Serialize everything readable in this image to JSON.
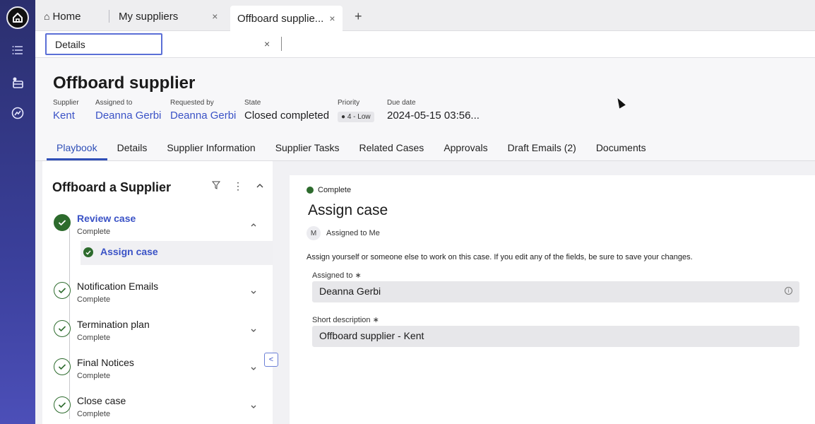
{
  "rail": {
    "icons": [
      "home-icon",
      "list-icon",
      "workspace-icon",
      "analytics-icon"
    ]
  },
  "tabs": {
    "home": "Home",
    "my_suppliers": "My suppliers",
    "offboard": "Offboard supplie...",
    "close_glyph": "×",
    "add_glyph": "+"
  },
  "subtab": {
    "label": "Details",
    "close_glyph": "×"
  },
  "record": {
    "title": "Offboard supplier",
    "fields": {
      "supplier": {
        "label": "Supplier",
        "value": "Kent"
      },
      "assigned_to": {
        "label": "Assigned to",
        "value": "Deanna Gerbi"
      },
      "requested_by": {
        "label": "Requested by",
        "value": "Deanna Gerbi"
      },
      "state": {
        "label": "State",
        "value": "Closed completed"
      },
      "priority": {
        "label": "Priority",
        "value": "4 - Low"
      },
      "due_date": {
        "label": "Due date",
        "value": "2024-05-15 03:56..."
      }
    },
    "tabs": [
      "Playbook",
      "Details",
      "Supplier Information",
      "Supplier Tasks",
      "Related Cases",
      "Approvals",
      "Draft Emails (2)",
      "Documents"
    ]
  },
  "playbook": {
    "title": "Offboard a Supplier",
    "steps": [
      {
        "name": "Review case",
        "status": "Complete"
      },
      {
        "name": "Notification Emails",
        "status": "Complete"
      },
      {
        "name": "Termination plan",
        "status": "Complete"
      },
      {
        "name": "Final Notices",
        "status": "Complete"
      },
      {
        "name": "Close case",
        "status": "Complete"
      }
    ],
    "active_substep": "Assign case",
    "collapse_glyph": "<"
  },
  "activity": {
    "status": "Complete",
    "title": "Assign case",
    "assignee_initial": "M",
    "assignee_text": "Assigned to Me",
    "description": "Assign yourself or someone else to work on this case. If you edit any of the fields, be sure to save your changes.",
    "assigned_to_label": "Assigned to ∗",
    "assigned_to_value": "Deanna Gerbi",
    "short_desc_label": "Short description ∗",
    "short_desc_value": "Offboard supplier - Kent"
  },
  "colors": {
    "accent": "#3a52c6",
    "complete_green": "#2d6b2d",
    "rail": "#3a3f9a"
  }
}
